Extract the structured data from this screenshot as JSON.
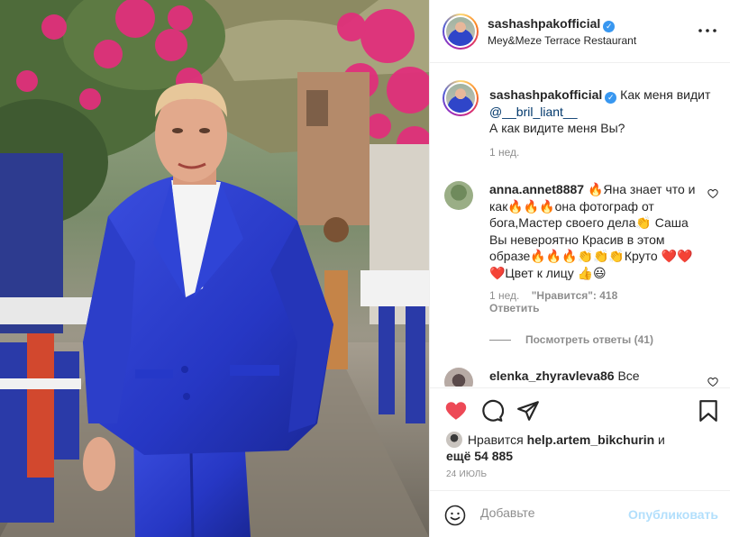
{
  "post": {
    "username": "sashashpakofficial",
    "location": "Mey&Meze Terrace Restaurant",
    "verified_icon": "verified-badge-icon",
    "more_icon": "more-horizontal-icon"
  },
  "caption": {
    "username": "sashashpakofficial",
    "text_before": " Как меня видит ",
    "mention": "@__bril_liant__",
    "text_after": "А как видите меня Вы?",
    "time": "1 нед."
  },
  "comments": [
    {
      "username": "anna.annet8887",
      "text": "🔥Яна знает что и как🔥🔥🔥она фотограф от бога,Мастер своего дела👏 Саша Вы невероятно Красив в этом образе🔥🔥🔥👏👏👏Круто ❤️❤️❤️Цвет к лицу 👍😃",
      "time": "1 нед.",
      "likes": "\"Нравится\": 418",
      "reply": "Ответить",
      "view_replies": "Посмотреть ответы (41)"
    },
    {
      "username": "elenka_zhyravleva86",
      "text": " Все"
    }
  ],
  "actions": {
    "liked_by_prefix": "Нравится ",
    "liked_by_user": "help.artem_bikchurin",
    "liked_by_mid": " и",
    "liked_by_more": "ещё 54 885",
    "date": "24 ИЮЛЬ",
    "colors": {
      "like_active": "#ed4956",
      "publish_disabled": "#b2dffc"
    }
  },
  "add_comment": {
    "placeholder": "Добавьте комментарий...",
    "placeholder_visible": "Добавьте",
    "publish_label": "Опубликовать"
  }
}
